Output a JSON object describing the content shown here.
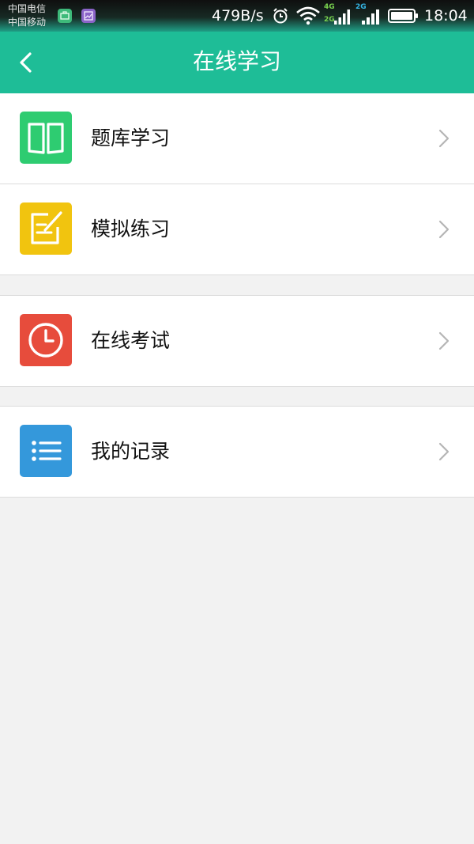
{
  "status_bar": {
    "carrier_1": "中国电信",
    "carrier_2": "中国移动",
    "net_speed": "479B/s",
    "sim1_top": "4G",
    "sim1_bottom": "2G",
    "sim2_top": "2G",
    "time": "18:04"
  },
  "app_bar": {
    "title": "在线学习"
  },
  "menu": {
    "items": [
      {
        "label": "题库学习",
        "icon": "book-icon",
        "color": "#2ecc71"
      },
      {
        "label": "模拟练习",
        "icon": "edit-note-icon",
        "color": "#f1c40f"
      },
      {
        "label": "在线考试",
        "icon": "clock-icon",
        "color": "#e74c3c"
      },
      {
        "label": "我的记录",
        "icon": "list-icon",
        "color": "#3498db"
      }
    ]
  },
  "colors": {
    "primary": "#1ebd97",
    "background": "#f2f2f2"
  }
}
